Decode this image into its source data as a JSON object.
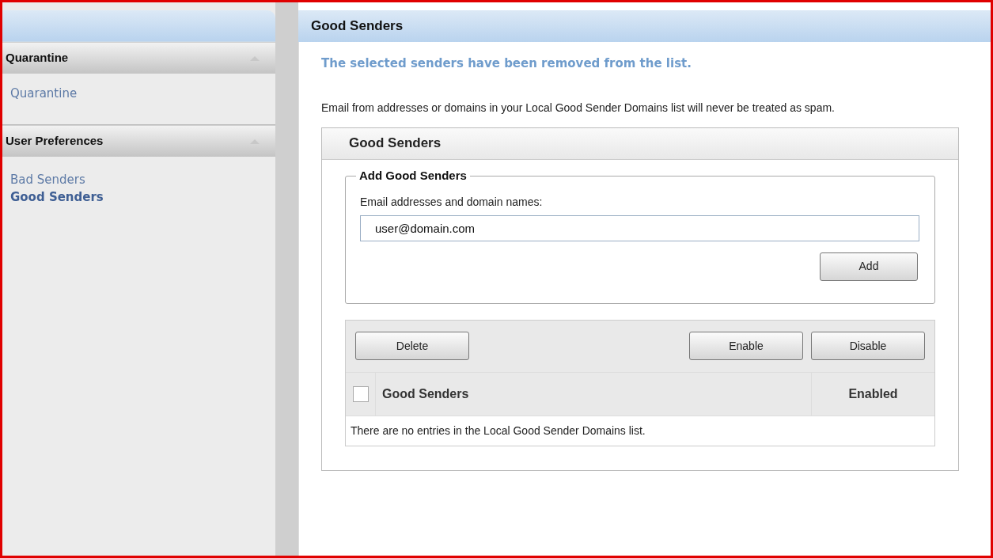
{
  "sidebar": {
    "sections": [
      {
        "title": "Quarantine",
        "expanded": true,
        "items": [
          {
            "label": "Quarantine",
            "selected": false
          }
        ]
      },
      {
        "title": "User Preferences",
        "expanded": true,
        "items": [
          {
            "label": "Bad Senders",
            "selected": false
          },
          {
            "label": "Good Senders",
            "selected": true
          }
        ]
      }
    ]
  },
  "main": {
    "title": "Good Senders",
    "message": "The selected senders have been removed from the list.",
    "description": "Email from addresses or domains in your Local Good Sender Domains list will never be treated as spam.",
    "panel": {
      "title": "Good Senders",
      "add_group": {
        "legend": "Add Good Senders",
        "field_label": "Email addresses and domain names:",
        "value": "user@domain.com",
        "button": "Add"
      },
      "actions_left": [
        "Delete"
      ],
      "actions_right": [
        "Enable",
        "Disable"
      ],
      "table": {
        "select_all_checked": false,
        "columns": [
          "Good Senders",
          "Enabled"
        ],
        "empty_message": "There are no entries in the Local Good Sender Domains list."
      }
    }
  }
}
